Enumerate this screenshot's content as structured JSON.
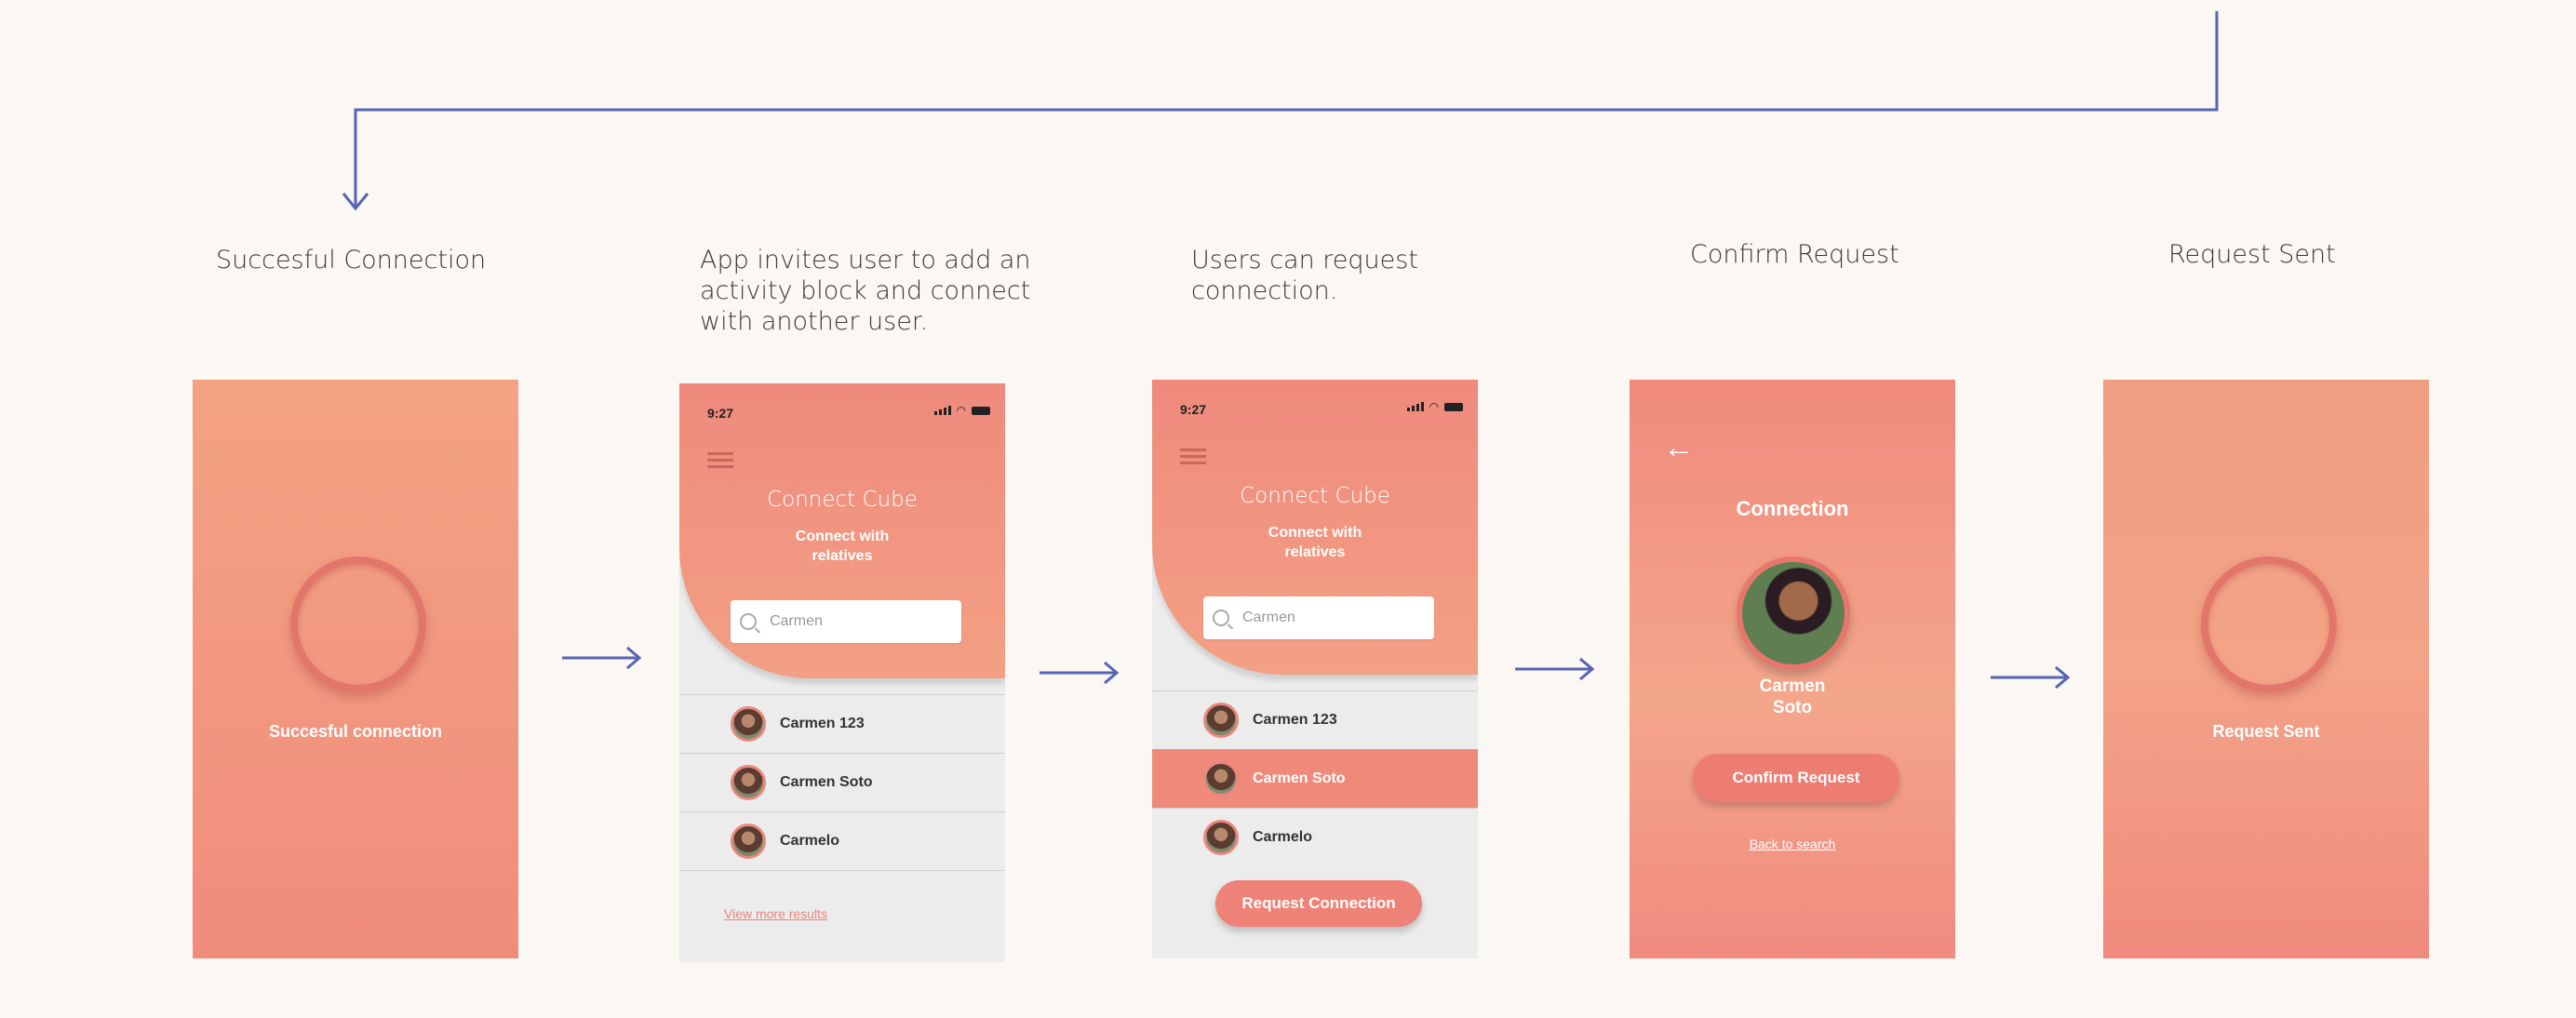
{
  "colors": {
    "accent": "#ef8a7b",
    "connector": "#5665b5",
    "background": "#fbf7f2"
  },
  "captions": {
    "step1": "Succesful Connection",
    "step2": "App invites user to add an\nactivity block and connect\nwith another user.",
    "step3": "Users can request\nconnection.",
    "step4": "Confirm Request",
    "step5": "Request Sent"
  },
  "screen_success": {
    "label": "Succesful connection"
  },
  "screen_search": {
    "time": "9:27",
    "title": "Connect Cube",
    "subtitle": "Connect with\nrelatives",
    "search_value": "Carmen",
    "results": [
      "Carmen 123",
      "Carmen Soto",
      "Carmelo"
    ],
    "more_link": "View more results"
  },
  "screen_request": {
    "time": "9:27",
    "title": "Connect Cube",
    "subtitle": "Connect with\nrelatives",
    "search_value": "Carmen",
    "results": [
      "Carmen 123",
      "Carmen Soto",
      "Carmelo"
    ],
    "selected_result": "Carmen Soto",
    "button_label": "Request Connection"
  },
  "screen_confirm": {
    "back_icon": "←",
    "title": "Connection",
    "person_name": "Carmen\nSoto",
    "button_label": "Confirm Request",
    "back_link": "Back to search"
  },
  "screen_sent": {
    "label": "Request Sent"
  }
}
